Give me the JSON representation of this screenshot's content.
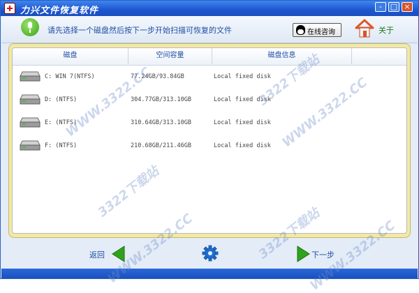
{
  "window": {
    "title": "力兴文件恢复软件",
    "controls": {
      "minimize": "-",
      "maximize": "□",
      "close": "×"
    }
  },
  "toolbar": {
    "instruction": "请先选择一个磁盘然后按下一步开始扫描可恢复的文件",
    "online_button": "在线咨询",
    "about": "关于"
  },
  "table": {
    "columns": [
      "磁盘",
      "空间容量",
      "磁盘信息"
    ],
    "rows": [
      {
        "name": "C: WIN 7(NTFS)",
        "capacity": "77.24GB/93.84GB",
        "info": "Local fixed disk"
      },
      {
        "name": "D: (NTFS)",
        "capacity": "304.77GB/313.10GB",
        "info": "Local fixed disk"
      },
      {
        "name": "E: (NTFS)",
        "capacity": "310.64GB/313.10GB",
        "info": "Local fixed disk"
      },
      {
        "name": "F: (NTFS)",
        "capacity": "210.68GB/211.46GB",
        "info": "Local fixed disk"
      }
    ]
  },
  "bottom": {
    "back_label": "返回",
    "next_label": "下一步"
  },
  "watermarks": [
    "3322下载站",
    "WWW.3322.CC"
  ],
  "colors": {
    "title_bar": "#1d56d0",
    "panel_frame": "#f3e9a6",
    "arrow_green": "#2fa31d",
    "label_blue": "#1f4ea3"
  }
}
